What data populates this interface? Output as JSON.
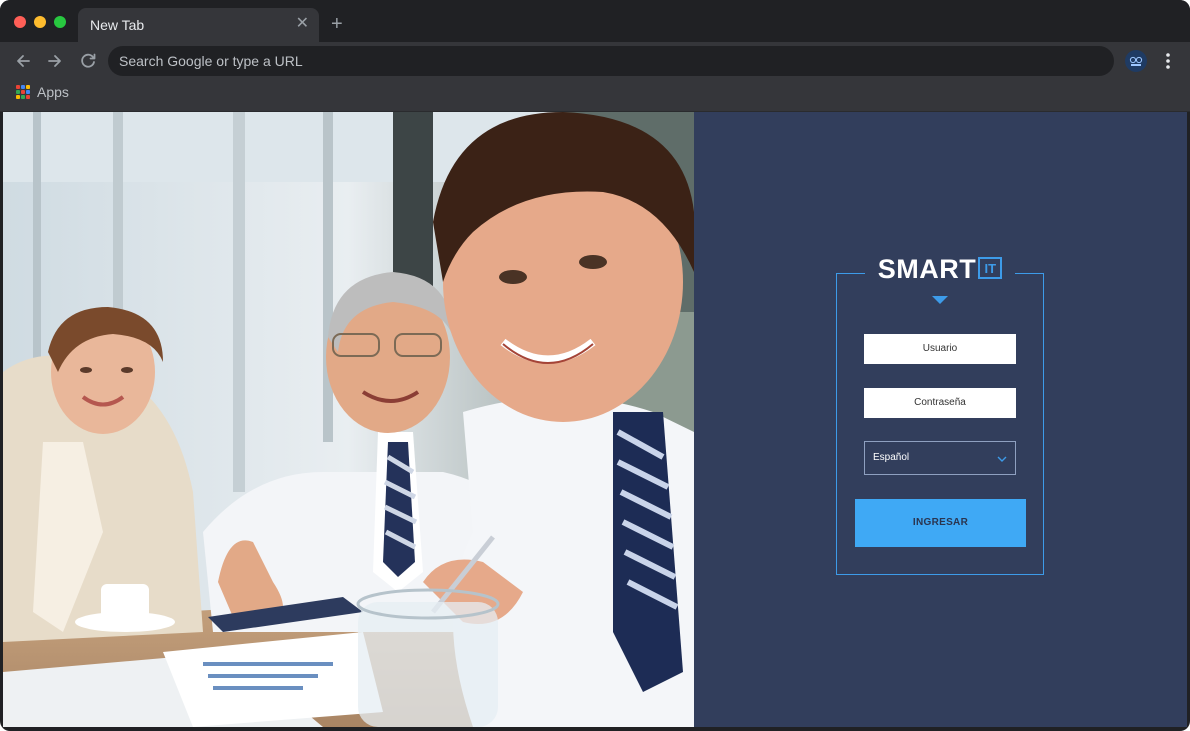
{
  "browser": {
    "tab_title": "New Tab",
    "omnibox_placeholder": "Search Google or type a URL",
    "bookmarks": [
      {
        "label": "Apps"
      }
    ]
  },
  "login": {
    "logo_text": "SMART",
    "logo_badge": "IT",
    "username_placeholder": "Usuario",
    "password_placeholder": "Contraseña",
    "language_selected": "Español",
    "submit_label": "INGRESAR"
  },
  "colors": {
    "panel_bg": "#323e5c",
    "accent": "#3d9be9",
    "button_bg": "#3fa9f5"
  }
}
